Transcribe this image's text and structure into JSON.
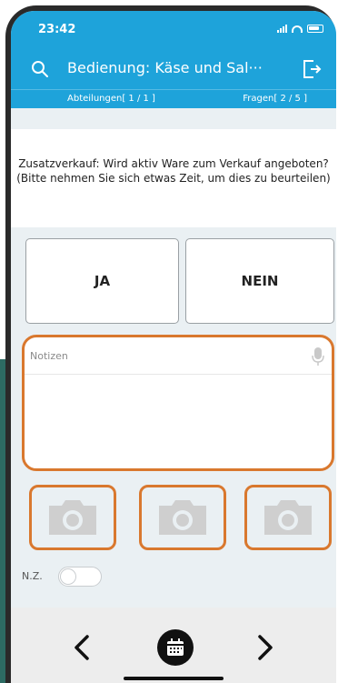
{
  "status": {
    "time": "23:42"
  },
  "header": {
    "title": "Bedienung: Käse und Sal···"
  },
  "subheader": {
    "departments": "Abteilungen[ 1 / 1 ]",
    "questions": "Fragen[ 2 / 5 ]"
  },
  "question": {
    "text": "Zusatzverkauf: Wird aktiv Ware zum Verkauf angeboten? (Bitte nehmen Sie sich etwas Zeit, um dies zu beurteilen)"
  },
  "answers": {
    "yes": "JA",
    "no": "NEIN"
  },
  "notes": {
    "placeholder": "Notizen"
  },
  "nz": {
    "label": "N.Z.",
    "enabled": false
  },
  "colors": {
    "accent": "#1ea3da",
    "highlight": "#d9782e",
    "background": "#eaf0f3"
  },
  "icons": [
    "search-icon",
    "exit-icon",
    "microphone-icon",
    "camera-icon",
    "chevron-left-icon",
    "calendar-icon",
    "chevron-right-icon"
  ]
}
